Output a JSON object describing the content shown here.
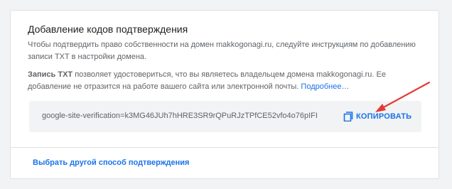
{
  "card": {
    "title": "Добавление кодов подтверждения",
    "description": "Чтобы подтвердить право собственности на домен makkogonagi.ru, следуйте инструкциям по добавлению записи TXT в настройки домена.",
    "txt_label": "Запись TXT",
    "txt_text": " позволяет удостовериться, что вы являетесь владельцем домена makkogonagi.ru. Ее добавление не отразится на работе вашего сайта или электронной почты. ",
    "more_link": "Подробнее…"
  },
  "verification": {
    "code": "google-site-verification=k3MG46JUh7hHRE3SR9rQPuRJzTPfCE52vfo4o76pIFI",
    "copy_label": "КОПИРОВАТЬ",
    "copy_icon": "copy-icon"
  },
  "alt_method_link": "Выбрать другой способ подтверждения",
  "colors": {
    "accent": "#1a73e8",
    "arrow": "#e53935",
    "text_primary": "#202124",
    "text_secondary": "#5f6368"
  }
}
